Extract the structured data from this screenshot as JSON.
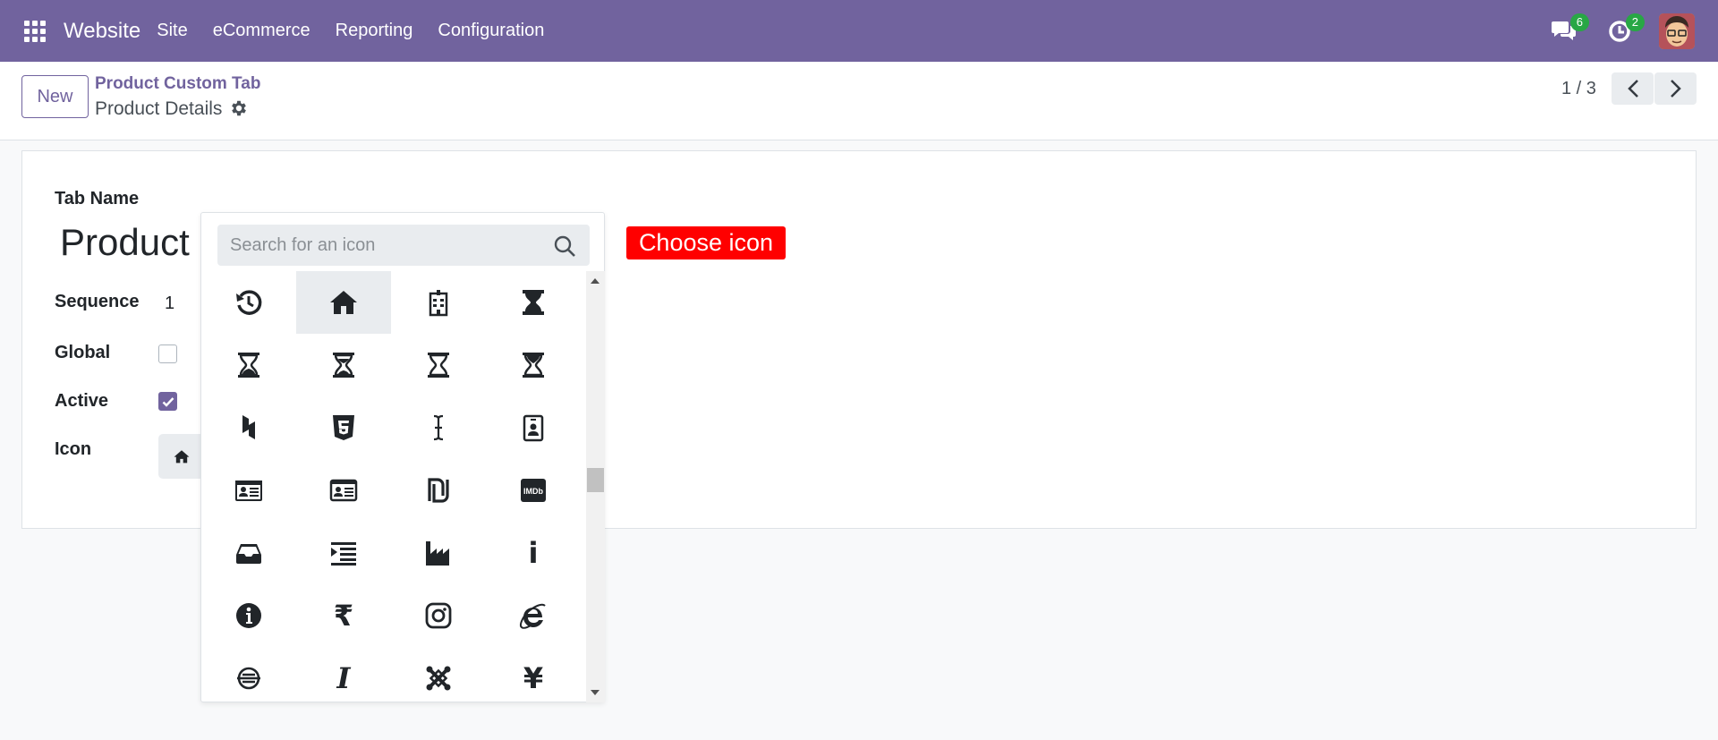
{
  "navbar": {
    "brand": "Website",
    "menu": [
      "Site",
      "eCommerce",
      "Reporting",
      "Configuration"
    ],
    "messages_badge": "6",
    "activities_badge": "2"
  },
  "control_panel": {
    "new_label": "New",
    "breadcrumb_parent": "Product Custom Tab",
    "breadcrumb_current": "Product Details",
    "pager": "1 / 3"
  },
  "form": {
    "tab_name_label": "Tab Name",
    "tab_name_value": "Product",
    "sequence_label": "Sequence",
    "sequence_value": "1",
    "global_label": "Global",
    "global_checked": false,
    "active_label": "Active",
    "active_checked": true,
    "icon_label": "Icon",
    "icon_value": "home-icon"
  },
  "icon_picker": {
    "search_placeholder": "Search for an icon",
    "icons": [
      "history-icon",
      "home-icon",
      "hospital-icon",
      "hourglass-icon",
      "hourglass-end-icon",
      "hourglass-half-icon",
      "hourglass-o-icon",
      "hourglass-start-icon",
      "houzz-icon",
      "html5-icon",
      "i-cursor-icon",
      "id-badge-icon",
      "id-card-icon",
      "id-card-o-icon",
      "ils-icon",
      "imdb-icon",
      "inbox-icon",
      "indent-icon",
      "industry-icon",
      "info-icon",
      "info-circle-icon",
      "inr-icon",
      "instagram-icon",
      "internet-explorer-icon",
      "intersex-icon",
      "italic-icon",
      "joomla-icon",
      "jpy-icon"
    ],
    "selected_icon": "home-icon",
    "imdb_text": "IMDb",
    "rupee_glyph": "₹",
    "yen_glyph": "¥",
    "info_glyph": "i",
    "italic_glyph": "I"
  },
  "annotation": {
    "text": "Choose icon",
    "color": "#ff0000"
  },
  "colors": {
    "navbar": "#71639e",
    "primary": "#71639e",
    "badge": "#28a745"
  }
}
